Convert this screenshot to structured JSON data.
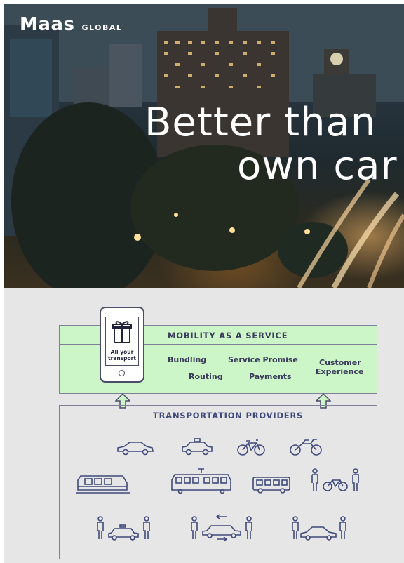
{
  "hero": {
    "logo_main": "Maas",
    "logo_sub": "GLOBAL",
    "headline_line1": "Better than",
    "headline_line2": "own car"
  },
  "maas": {
    "title": "MOBILITY AS A SERVICE",
    "phone_text_line1": "All your",
    "phone_text_line2": "transport",
    "services": {
      "bundling": "Bundling",
      "service_promise": "Service Promise",
      "customer_line1": "Customer",
      "customer_line2": "Experience",
      "routing": "Routing",
      "payments": "Payments"
    }
  },
  "providers": {
    "title": "TRANSPORTATION PROVIDERS",
    "icons": [
      "car-icon",
      "taxi-icon",
      "bicycle-icon",
      "motorcycle-icon",
      "train-icon",
      "tram-icon",
      "bus-icon",
      "bike-sharing-icon",
      "taxi-ride-icon",
      "ride-sharing-icon",
      "car-sharing-icon"
    ]
  },
  "colors": {
    "maas_green": "#ccf5c8",
    "line": "#4b4b6a",
    "provider_text": "#3f4a7a",
    "diagram_bg": "#e6e6e6"
  }
}
